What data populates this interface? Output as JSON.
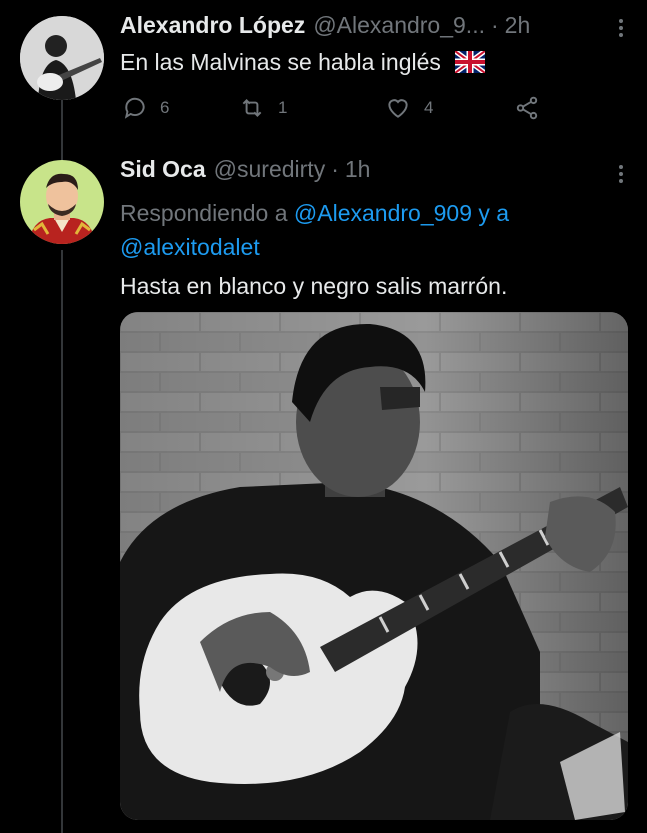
{
  "tweet1": {
    "name": "Alexandro López",
    "handle": "@Alexandro_9...",
    "separator": "·",
    "time": "2h",
    "text": "En las Malvinas se habla inglés",
    "flag_icon": "uk-flag-icon",
    "reply_count": "6",
    "retweet_count": "1",
    "like_count": "4"
  },
  "tweet2": {
    "name": "Sid Oca",
    "handle": "@suredirty",
    "separator": "·",
    "time": "1h",
    "replying_prefix": "Respondiendo a",
    "replying_user1": "@Alexandro_909",
    "replying_and": "y a",
    "replying_user2": "@alexitodalet",
    "text": "Hasta en blanco y negro salis marrón."
  },
  "colors": {
    "background": "#000000",
    "text": "#e7e9ea",
    "muted": "#71767b",
    "link": "#1d9bf0",
    "divider": "#333639"
  }
}
